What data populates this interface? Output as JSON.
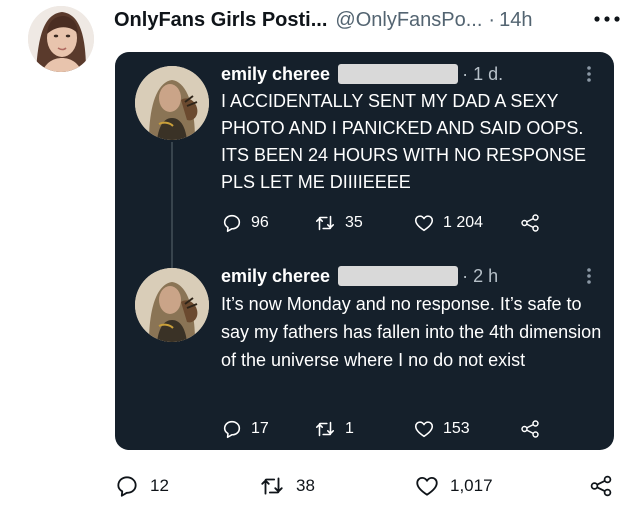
{
  "outer_tweet": {
    "author_name": "OnlyFans Girls Posti...",
    "handle": "@OnlyFansPo...",
    "separator": "·",
    "time": "14h",
    "more_label": "•••",
    "actions": {
      "replies": "12",
      "retweets": "38",
      "likes": "1,017"
    }
  },
  "embedded_posts": [
    {
      "author_name": "emily cheree",
      "time": "· 1 d.",
      "more_label": "⋮",
      "text": "I ACCIDENTALLY SENT MY DAD A SEXY PHOTO AND I PANICKED AND SAID OOPS. ITS BEEN 24 HOURS WITH NO RESPONSE PLS LET ME DIIIIEEEE",
      "replies": "96",
      "retweets": "35",
      "likes": "1 204"
    },
    {
      "author_name": "emily cheree",
      "time": "· 2 h",
      "more_label": "⋮",
      "text": "It’s now Monday and no response. It’s safe to say my fathers has fallen into the 4th dimension of the universe where I no do not exist",
      "replies": "17",
      "retweets": "1",
      "likes": "153"
    }
  ],
  "colors": {
    "card_bg": "#15202b",
    "thread_line": "#38444d",
    "muted_text": "#536471"
  }
}
